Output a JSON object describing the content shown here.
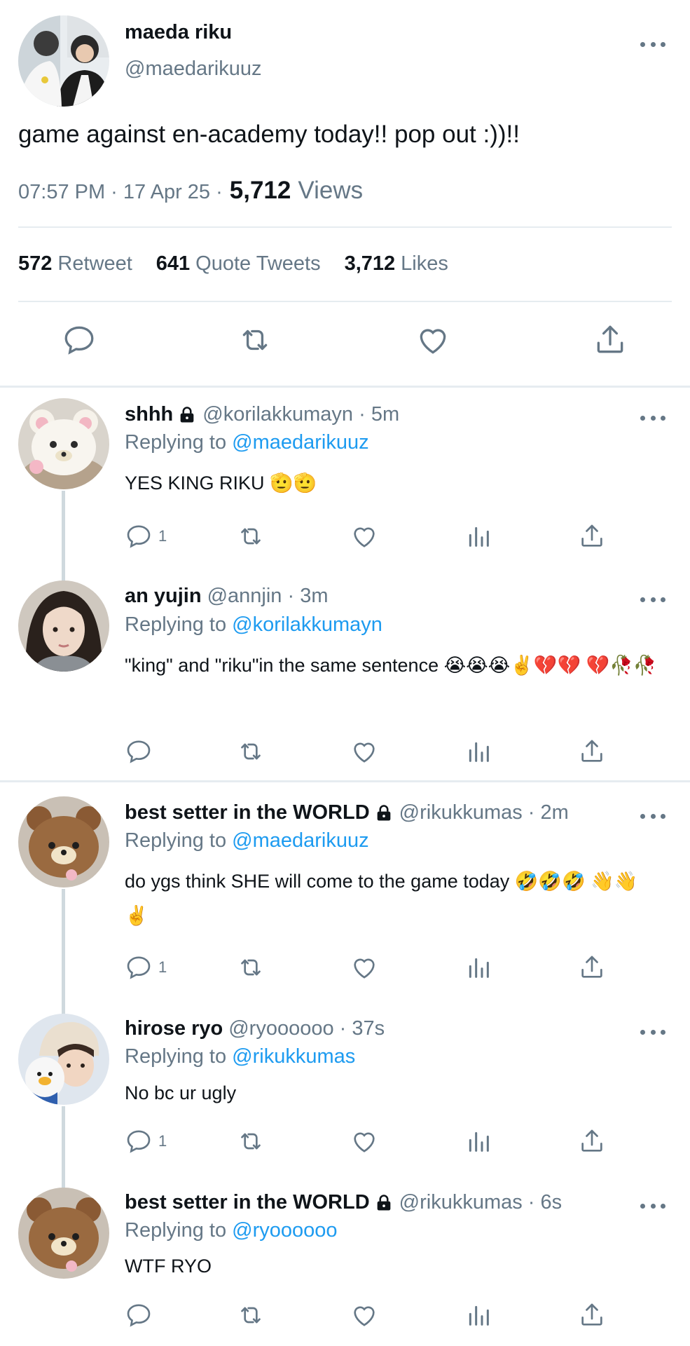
{
  "main_tweet": {
    "name": "maeda riku",
    "handle": "@maedarikuuz",
    "text": "game against en-academy today!! pop out :))!!",
    "time": "07:57 PM · 17 Apr 25 ·",
    "views_count": "5,712",
    "views_label": "Views",
    "retweets_count": "572",
    "retweets_label": "Retweet",
    "quotes_count": "641",
    "quotes_label": "Quote Tweets",
    "likes_count": "3,712",
    "likes_label": "Likes",
    "icons": [
      "reply-icon",
      "retweet-icon",
      "like-icon",
      "share-icon"
    ]
  },
  "replies": [
    {
      "name": "shhh",
      "locked": true,
      "handle_time": "@korilakkumayn · 5m",
      "replying_prefix": "Replying to",
      "replying_to": "@maedarikuuz",
      "text": "YES KING RIKU 🫡🫡",
      "reply_count": "1"
    },
    {
      "name": "an yujin",
      "locked": false,
      "handle_time": "@annjin · 3m",
      "replying_prefix": "Replying to",
      "replying_to": "@korilakkumayn",
      "text": "\"king\" and \"riku\"in the same sentence 😭😭😭✌️💔💔 💔🥀🥀",
      "reply_count": ""
    },
    {
      "name": "best setter in the WORLD",
      "locked": true,
      "handle_time": "@rikukkumas · 2m",
      "replying_prefix": "Replying to",
      "replying_to": "@maedarikuuz",
      "text": "do ygs think SHE will come to the game today 🤣🤣🤣 👋👋✌️",
      "reply_count": "1"
    },
    {
      "name": "hirose ryo",
      "locked": false,
      "handle_time": "@ryoooooo · 37s",
      "replying_prefix": "Replying to",
      "replying_to": "@rikukkumas",
      "text": "No bc ur ugly",
      "reply_count": "1"
    },
    {
      "name": "best setter in the WORLD",
      "locked": true,
      "handle_time": "@rikukkumas · 6s",
      "replying_prefix": "Replying to",
      "replying_to": "@ryoooooo",
      "text": "WTF RYO",
      "reply_count": ""
    }
  ],
  "colors": {
    "text": "#0f1419",
    "secondary": "#657786",
    "link": "#1d9bf0",
    "divider": "#e6ecf0",
    "thread_line": "#cfd9de"
  }
}
